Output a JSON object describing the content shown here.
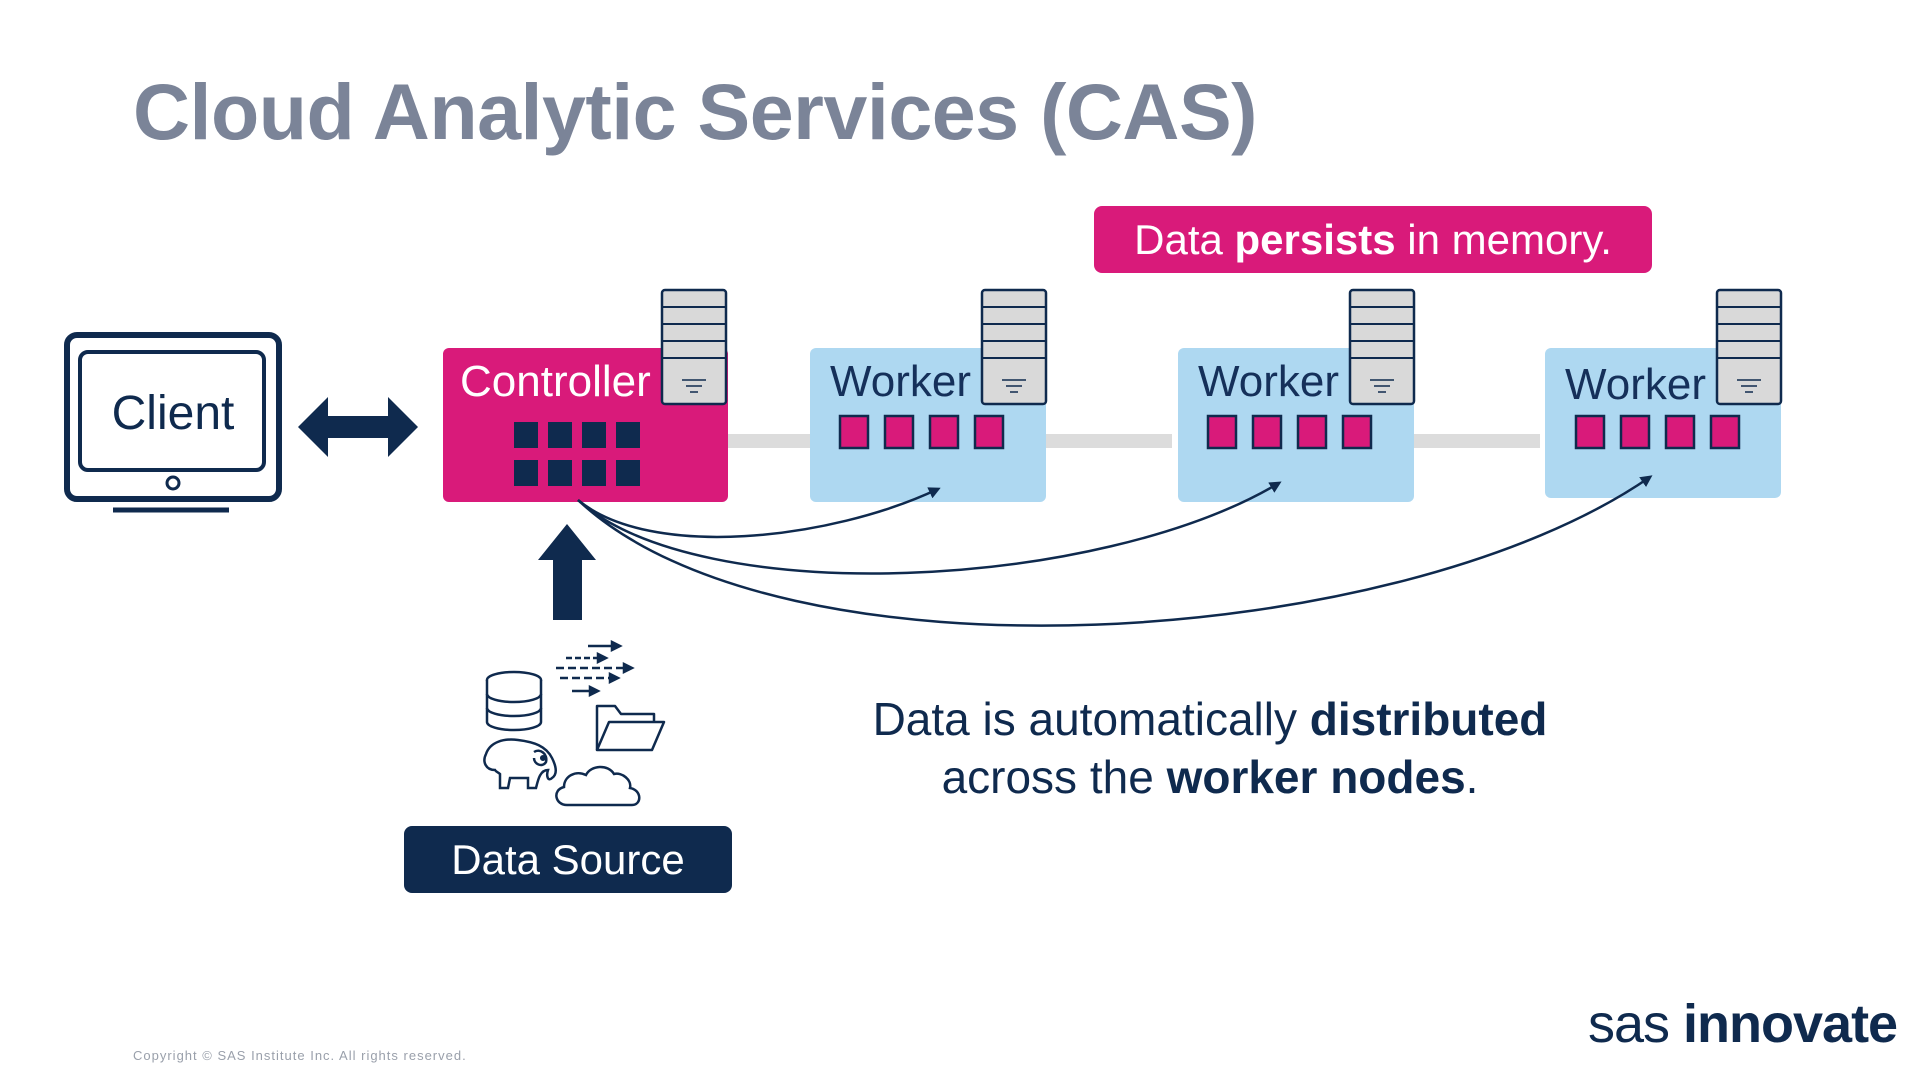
{
  "title": "Cloud Analytic Services (CAS)",
  "banner": {
    "pre": "Data ",
    "bold": "persists",
    "post": " in memory."
  },
  "client": {
    "label": "Client"
  },
  "controller": {
    "label": "Controller"
  },
  "workers": [
    {
      "label": "Worker"
    },
    {
      "label": "Worker"
    },
    {
      "label": "Worker"
    }
  ],
  "caption": {
    "line1_pre": "Data is automatically ",
    "line1_bold": "distributed",
    "line2_pre": "across the ",
    "line2_bold": "worker nodes",
    "line2_post": "."
  },
  "data_source": {
    "label": "Data Source"
  },
  "copyright": "Copyright © SAS Institute Inc. All rights reserved.",
  "brand": {
    "light": "sas ",
    "bold": "innovate"
  },
  "colors": {
    "magenta": "#d91a7a",
    "navy": "#0f2a4e",
    "light_blue": "#aed8f1",
    "title_gray": "#7b8498",
    "connector_gray": "#dcdcdc",
    "server_gray": "#d9d9d9"
  },
  "icons": [
    "monitor-icon",
    "double-arrow-icon",
    "server-icon",
    "up-arrow-icon",
    "database-icon",
    "stream-arrows-icon",
    "folder-icon",
    "elephant-icon",
    "cloud-icon"
  ]
}
